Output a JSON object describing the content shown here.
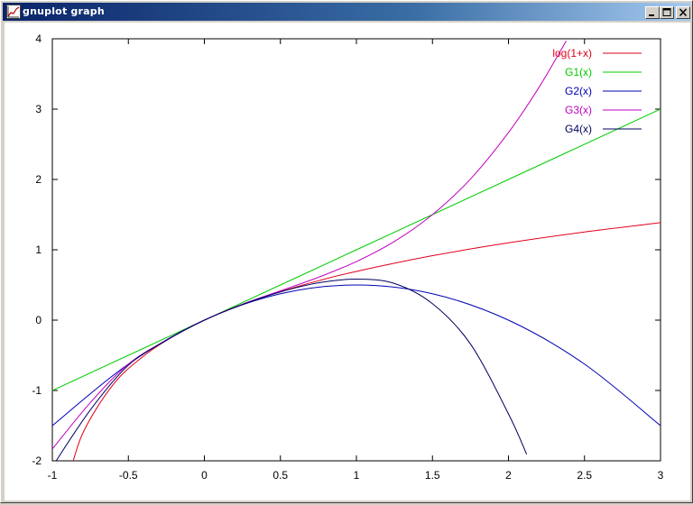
{
  "window": {
    "title": "gnuplot graph",
    "icons": {
      "app": "gnuplot-app-icon",
      "minimize": "minimize-icon",
      "maximize": "maximize-icon",
      "close": "close-icon"
    }
  },
  "chart_data": {
    "type": "line",
    "title": "",
    "xlabel": "",
    "ylabel": "",
    "xlim": [
      -1,
      3
    ],
    "ylim": [
      -2,
      4
    ],
    "xticks": [
      "-1",
      "-0.5",
      "0",
      "0.5",
      "1",
      "1.5",
      "2",
      "2.5",
      "3"
    ],
    "yticks": [
      "-2",
      "-1",
      "0",
      "1",
      "2",
      "3",
      "4"
    ],
    "grid": false,
    "legend_position": "top-right",
    "series": [
      {
        "name": "log(1+x)",
        "color": "#e0001a",
        "x": [
          -0.9,
          -0.8,
          -0.6,
          -0.4,
          -0.2,
          0,
          0.25,
          0.5,
          0.75,
          1,
          1.5,
          2,
          2.5,
          3
        ],
        "y": [
          -2.303,
          -1.609,
          -0.916,
          -0.511,
          -0.223,
          0,
          0.223,
          0.405,
          0.56,
          0.693,
          0.916,
          1.099,
          1.253,
          1.386
        ]
      },
      {
        "name": "G1(x)",
        "color": "#00cc00",
        "x": [
          -1,
          0,
          1,
          2,
          3
        ],
        "y": [
          -1,
          0,
          1,
          2,
          3
        ]
      },
      {
        "name": "G2(x)",
        "color": "#0000b4",
        "x": [
          -1,
          -0.5,
          0,
          0.5,
          1,
          1.5,
          2,
          2.5,
          3
        ],
        "y": [
          -1.5,
          -0.625,
          0,
          0.375,
          0.5,
          0.375,
          0,
          -0.625,
          -1.5
        ]
      },
      {
        "name": "G3(x)",
        "color": "#c000c0",
        "x": [
          -1,
          -0.75,
          -0.5,
          -0.25,
          0,
          0.25,
          0.5,
          0.75,
          1,
          1.25,
          1.5,
          1.75,
          2,
          2.2,
          2.38
        ],
        "y": [
          -1.833,
          -1.172,
          -0.625,
          -0.286,
          0,
          0.227,
          0.417,
          0.609,
          0.833,
          1.119,
          1.5,
          2.006,
          2.667,
          3.307,
          3.97
        ]
      },
      {
        "name": "G4(x)",
        "color": "#000060",
        "x": [
          -1,
          -0.75,
          -0.5,
          -0.25,
          0,
          0.25,
          0.5,
          0.75,
          1,
          1.25,
          1.5,
          1.75,
          2,
          2.12
        ],
        "y": [
          -2.083,
          -1.277,
          -0.641,
          -0.287,
          0,
          0.222,
          0.401,
          0.53,
          0.583,
          0.521,
          0.234,
          -0.339,
          -1.333,
          -1.908
        ]
      }
    ]
  }
}
